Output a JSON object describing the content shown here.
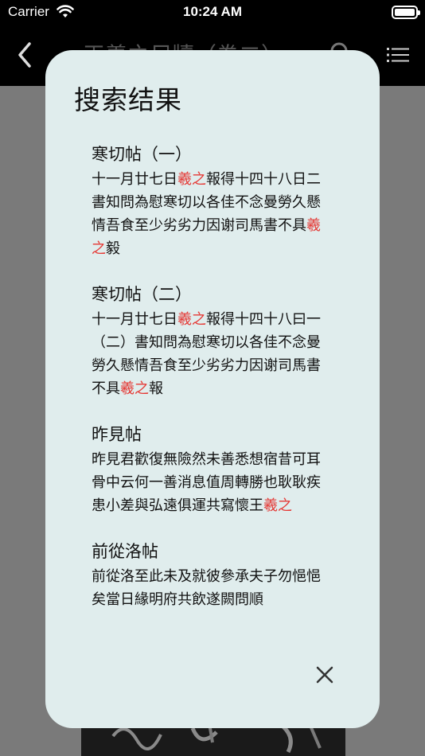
{
  "status_bar": {
    "carrier": "Carrier",
    "time": "10:24 AM"
  },
  "nav": {
    "title": "王羲之尺牘（卷二）",
    "back_icon": "chevron-left-icon",
    "search_icon": "search-icon",
    "menu_icon": "list-icon"
  },
  "modal": {
    "title": "搜索结果",
    "close_icon": "close-icon",
    "highlight_color": "#e53935",
    "background_color": "#e0eded",
    "results": [
      {
        "title": "寒切帖（一）",
        "snippet": [
          {
            "text": "十一月廿七日"
          },
          {
            "text": "羲之",
            "hl": true
          },
          {
            "text": "報得十四十八日二書知問為慰寒切以各佳不念曼勞久懸情吾食至少劣劣力因谢司馬書不具"
          },
          {
            "text": "羲之",
            "hl": true
          },
          {
            "text": "毅"
          }
        ]
      },
      {
        "title": "寒切帖（二）",
        "snippet": [
          {
            "text": "十一月廿七日"
          },
          {
            "text": "羲之",
            "hl": true
          },
          {
            "text": "報得十四十八曰一（二）書知問為慰寒切以各佳不念曼勞久懸情吾食至少劣劣力因谢司馬書不具"
          },
          {
            "text": "羲之",
            "hl": true
          },
          {
            "text": "報"
          }
        ]
      },
      {
        "title": "昨見帖",
        "snippet": [
          {
            "text": "昨見君歡復無險然未善悉想宿昔可耳骨中云何一善消息值周轉勝也耿耿疾患小差與弘遠俱運共寫懷王"
          },
          {
            "text": "羲之",
            "hl": true
          }
        ]
      },
      {
        "title": "前從洛帖",
        "snippet": [
          {
            "text": "前從洛至此未及就彼參承夫子勿悒悒矣當日緣明府共飲遂闕問順"
          }
        ]
      }
    ]
  }
}
